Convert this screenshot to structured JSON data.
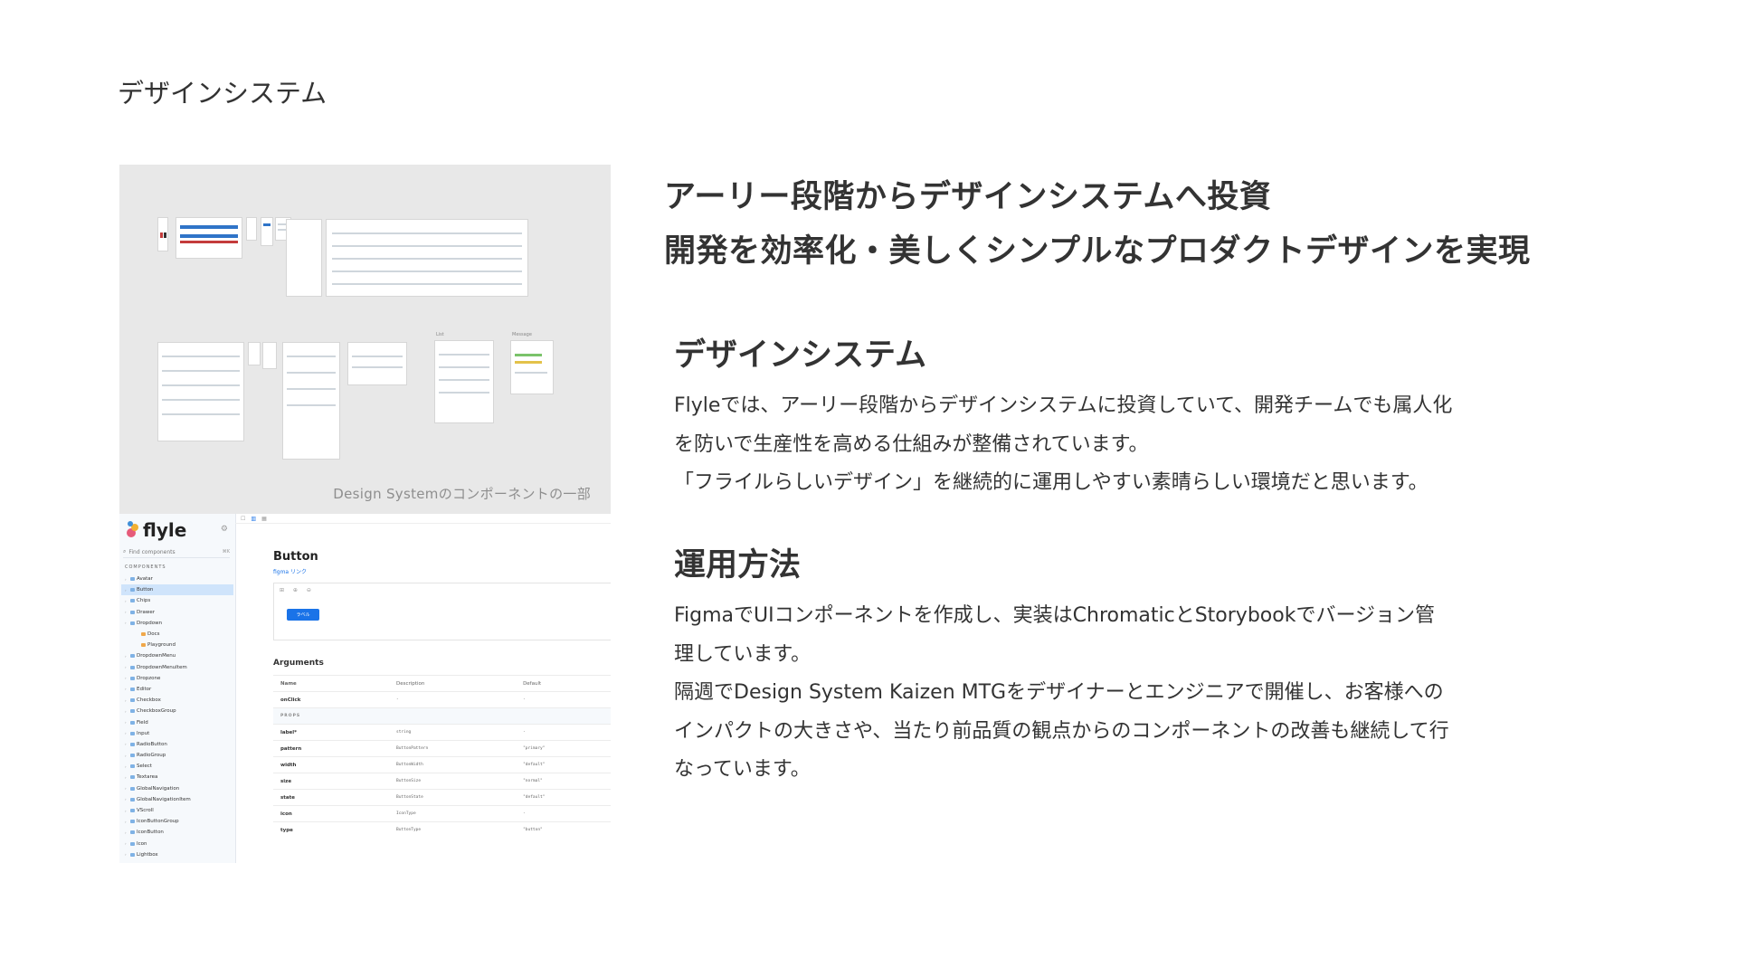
{
  "slide_title": "デザインシステム",
  "figma": {
    "caption": "Design Systemのコンポーネントの一部",
    "frame_labels": [
      "List",
      "Message"
    ]
  },
  "storybook": {
    "logo_text": "flyle",
    "search_placeholder": "Find components",
    "search_shortcut": "⌘K",
    "section_label": "COMPONENTS",
    "toolbar": [
      "☐",
      "▥",
      "▦"
    ],
    "tree": [
      {
        "label": "Avatar",
        "type": "component"
      },
      {
        "label": "Button",
        "type": "component",
        "active": true
      },
      {
        "label": "Chips",
        "type": "component"
      },
      {
        "label": "Drawer",
        "type": "component"
      },
      {
        "label": "Dropdown",
        "type": "component"
      },
      {
        "label": "Docs",
        "type": "doc"
      },
      {
        "label": "Playground",
        "type": "story"
      },
      {
        "label": "DropdownMenu",
        "type": "component"
      },
      {
        "label": "DropdownMenuItem",
        "type": "component"
      },
      {
        "label": "Dropzone",
        "type": "component"
      },
      {
        "label": "Editor",
        "type": "component"
      },
      {
        "label": "Checkbox",
        "type": "component"
      },
      {
        "label": "CheckboxGroup",
        "type": "component"
      },
      {
        "label": "Field",
        "type": "component"
      },
      {
        "label": "Input",
        "type": "component"
      },
      {
        "label": "RadioButton",
        "type": "component"
      },
      {
        "label": "RadioGroup",
        "type": "component"
      },
      {
        "label": "Select",
        "type": "component"
      },
      {
        "label": "Textarea",
        "type": "component"
      },
      {
        "label": "GlobalNavigation",
        "type": "component"
      },
      {
        "label": "GlobalNavigationItem",
        "type": "component"
      },
      {
        "label": "VScroll",
        "type": "component"
      },
      {
        "label": "IconButtonGroup",
        "type": "component"
      },
      {
        "label": "IconButton",
        "type": "component"
      },
      {
        "label": "Icon",
        "type": "component"
      },
      {
        "label": "Lightbox",
        "type": "component"
      }
    ],
    "component_title": "Button",
    "figma_link": "figma リンク",
    "preview_tools": "⊞ ⊕ ⊖",
    "preview_button_label": "ラベル",
    "arguments_title": "Arguments",
    "args_header": [
      "Name",
      "Description",
      "Default"
    ],
    "args_rows": [
      {
        "name": "onClick",
        "desc": "-",
        "def": "-"
      },
      {
        "group": "PROPS"
      },
      {
        "name": "label*",
        "desc": "string",
        "def": "-"
      },
      {
        "name": "pattern",
        "desc": "ButtonPattern",
        "def": "\"primary\""
      },
      {
        "name": "width",
        "desc": "ButtonWidth",
        "def": "\"default\""
      },
      {
        "name": "size",
        "desc": "ButtonSize",
        "def": "\"normal\""
      },
      {
        "name": "state",
        "desc": "ButtonState",
        "def": "\"default\""
      },
      {
        "name": "icon",
        "desc": "IconType",
        "def": "-"
      },
      {
        "name": "type",
        "desc": "ButtonType",
        "def": "\"button\""
      }
    ]
  },
  "headline": {
    "line1": "アーリー段階からデザインシステムへ投資",
    "line2": "開発を効率化・美しくシンプルなプロダクトデザインを実現"
  },
  "sections": [
    {
      "title": "デザインシステム",
      "lines": [
        "Flyleでは、アーリー段階からデザインシステムに投資していて、開発チームでも属人化",
        "を防いで生産性を高める仕組みが整備されています。",
        "「フライルらしいデザイン」を継続的に運用しやすい素晴らしい環境だと思います。"
      ]
    },
    {
      "title": "運用方法",
      "lines": [
        "FigmaでUIコンポーネントを作成し、実装はChromaticとStorybookでバージョン管",
        "理しています。",
        "隔週でDesign System Kaizen MTGをデザイナーとエンジニアで開催し、お客様への",
        "インパクトの大きさや、当たり前品質の観点からのコンポーネントの改善も継続して行",
        "なっています。"
      ]
    }
  ],
  "colors": {
    "accent_blue": "#1a73e8",
    "sidebar_active": "#cfe4fb",
    "figma_canvas": "#e8e8e8"
  }
}
